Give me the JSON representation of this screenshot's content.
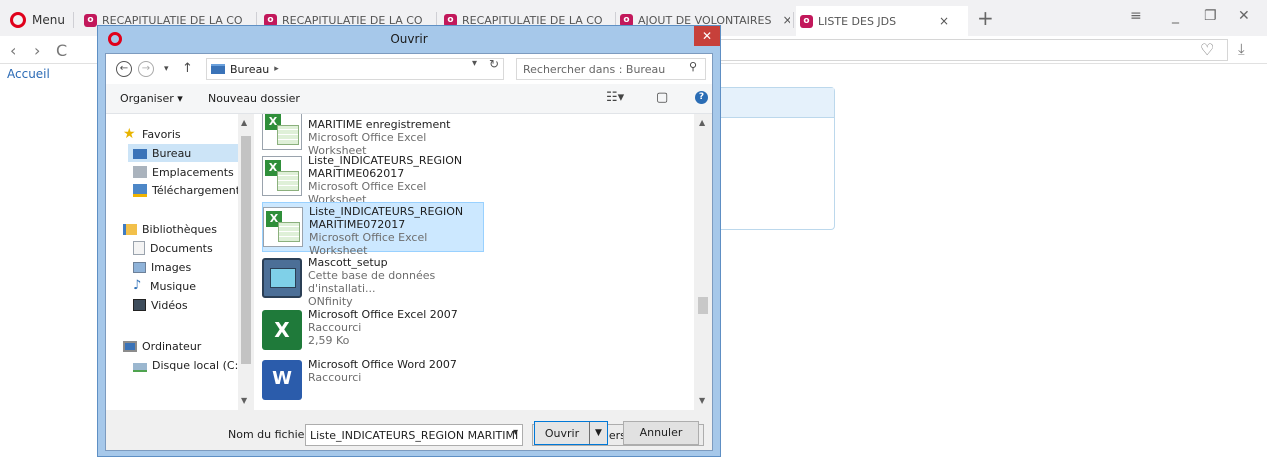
{
  "browser": {
    "menu_label": "Menu",
    "tabs": [
      {
        "label": "RECAPITULATIE DE LA CO",
        "favicon": "opera-page-icon"
      },
      {
        "label": "RECAPITULATIE DE LA CO",
        "favicon": "opera-page-icon"
      },
      {
        "label": "RECAPITULATIE DE LA CO",
        "favicon": "opera-page-icon"
      },
      {
        "label": "AJOUT DE VOLONTAIRES",
        "favicon": "opera-page-icon"
      },
      {
        "label": "LISTE DES JDS",
        "favicon": "opera-page-icon",
        "active": true
      }
    ],
    "close_glyph": "×",
    "new_tab_glyph": "+",
    "accent_color": "#e0001b"
  },
  "page": {
    "breadcrumb": "Accueil"
  },
  "dialog": {
    "title": "Ouvrir",
    "close_glyph": "✕",
    "path": {
      "location": "Bureau",
      "search_placeholder": "Rechercher dans : Bureau"
    },
    "toolbar": {
      "organize_label": "Organiser ▾",
      "new_folder_label": "Nouveau dossier"
    },
    "nav": {
      "favorites": "Favoris",
      "desktop": "Bureau",
      "places": "Emplacements ré",
      "downloads": "Téléchargements",
      "libraries": "Bibliothèques",
      "documents": "Documents",
      "images": "Images",
      "music": "Musique",
      "videos": "Vidéos",
      "computer": "Ordinateur",
      "local_disk": "Disque local (C:)"
    },
    "files": [
      {
        "line1": "MARITIME enregistrement",
        "line2": "Microsoft Office Excel Worksheet",
        "icon": "excel-worksheet-icon"
      },
      {
        "line1": "Liste_INDICATEURS_REGION",
        "line2": "MARITIME062017",
        "line3": "Microsoft Office Excel Worksheet",
        "icon": "excel-worksheet-icon"
      },
      {
        "line1": "Liste_INDICATEURS_REGION",
        "line2": "MARITIME072017",
        "line3": "Microsoft Office Excel Worksheet",
        "icon": "excel-worksheet-icon",
        "selected": true
      },
      {
        "line1": "Mascott_setup",
        "line2": "Cette base de données d'installati...",
        "line3": "ONfinity",
        "icon": "installer-icon"
      },
      {
        "line1": "Microsoft Office Excel 2007",
        "line2": "Raccourci",
        "line3": "2,59 Ko",
        "icon": "excel-app-icon"
      },
      {
        "line1": "Microsoft Office Word 2007",
        "line2": "Raccourci",
        "icon": "word-app-icon"
      }
    ],
    "footer": {
      "filename_label": "Nom du fichier :",
      "filename_value": "Liste_INDICATEURS_REGION MARITIMI",
      "filetype_value": "Tous les fichiers"
    },
    "buttons": {
      "open_label": "Ouvrir",
      "cancel_label": "Annuler"
    }
  }
}
